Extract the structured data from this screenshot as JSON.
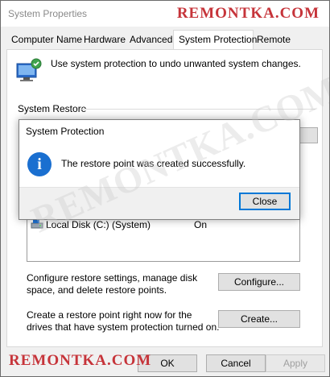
{
  "window": {
    "title": "System Properties"
  },
  "watermark": {
    "text": "REMONTKA.COM"
  },
  "tabs": [
    {
      "label": "Computer Name"
    },
    {
      "label": "Hardware"
    },
    {
      "label": "Advanced"
    },
    {
      "label": "System Protection",
      "selected": true
    },
    {
      "label": "Remote"
    }
  ],
  "protection": {
    "intro": "Use system protection to undo unwanted system changes.",
    "system_restore_label": "System Restore",
    "drives": [
      {
        "name": "Local Disk (C:) (System)",
        "protection": "On"
      }
    ],
    "configure_text": "Configure restore settings, manage disk space, and delete restore points.",
    "configure_label": "Configure...",
    "create_text": "Create a restore point right now for the drives that have system protection turned on.",
    "create_label": "Create..."
  },
  "footer": {
    "ok_label": "OK",
    "cancel_label": "Cancel",
    "apply_label": "Apply"
  },
  "dialog": {
    "title": "System Protection",
    "message": "The restore point was created successfully.",
    "close_label": "Close",
    "icon": "info-icon"
  },
  "colors": {
    "accent": "#0078d7",
    "watermark": "#c6343a",
    "info": "#1a6fd0"
  }
}
